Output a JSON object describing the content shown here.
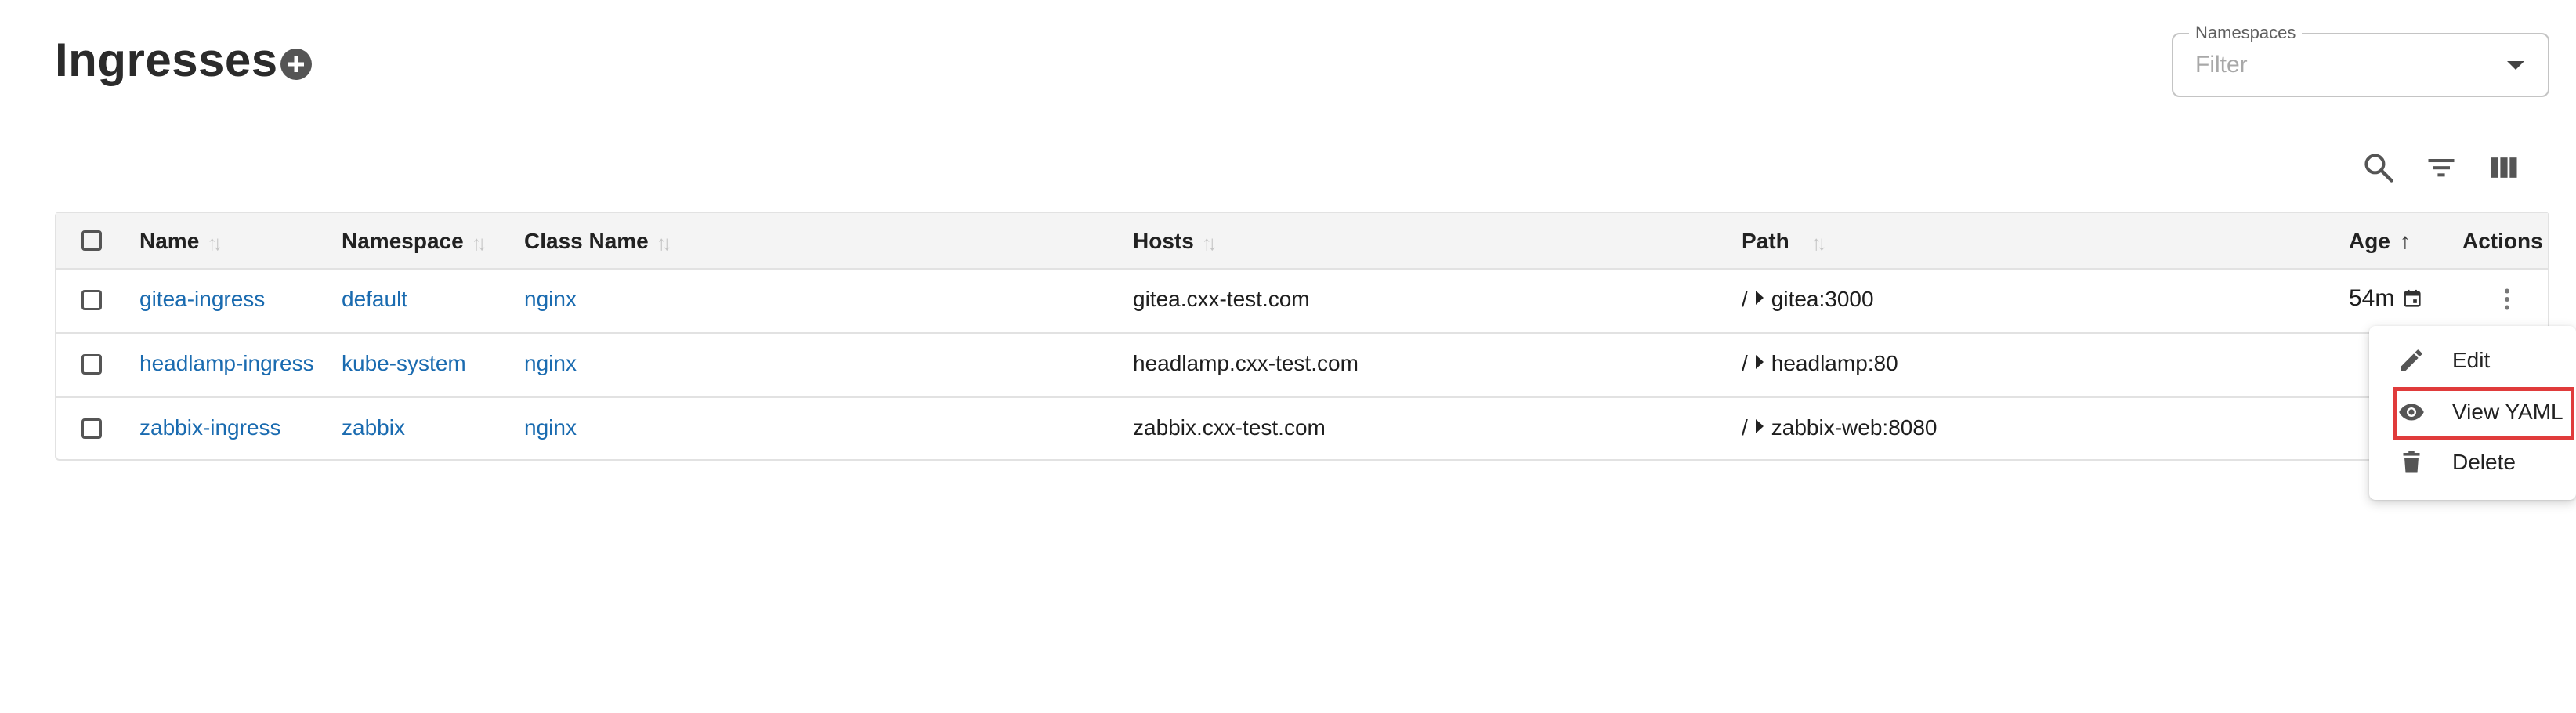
{
  "page": {
    "title": "Ingresses"
  },
  "namespaces": {
    "label": "Namespaces",
    "placeholder": "Filter"
  },
  "table": {
    "columns": {
      "name": "Name",
      "namespace": "Namespace",
      "class_name": "Class Name",
      "hosts": "Hosts",
      "path": "Path",
      "age": "Age",
      "actions": "Actions"
    },
    "rows": [
      {
        "name": "gitea-ingress",
        "namespace": "default",
        "class_name": "nginx",
        "hosts": "gitea.cxx-test.com",
        "path_prefix": "/",
        "path_target": "gitea:3000",
        "age": "54m"
      },
      {
        "name": "headlamp-ingress",
        "namespace": "kube-system",
        "class_name": "nginx",
        "hosts": "headlamp.cxx-test.com",
        "path_prefix": "/",
        "path_target": "headlamp:80"
      },
      {
        "name": "zabbix-ingress",
        "namespace": "zabbix",
        "class_name": "nginx",
        "hosts": "zabbix.cxx-test.com",
        "path_prefix": "/",
        "path_target": "zabbix-web:8080"
      }
    ]
  },
  "context_menu": {
    "items": [
      {
        "label": "Edit",
        "icon": "pencil-icon"
      },
      {
        "label": "View YAML",
        "icon": "eye-icon"
      },
      {
        "label": "Delete",
        "icon": "trash-icon"
      }
    ]
  },
  "colors": {
    "link": "#1a6bb0",
    "header_bg": "#f4f4f4",
    "highlight": "#e03b3b"
  }
}
